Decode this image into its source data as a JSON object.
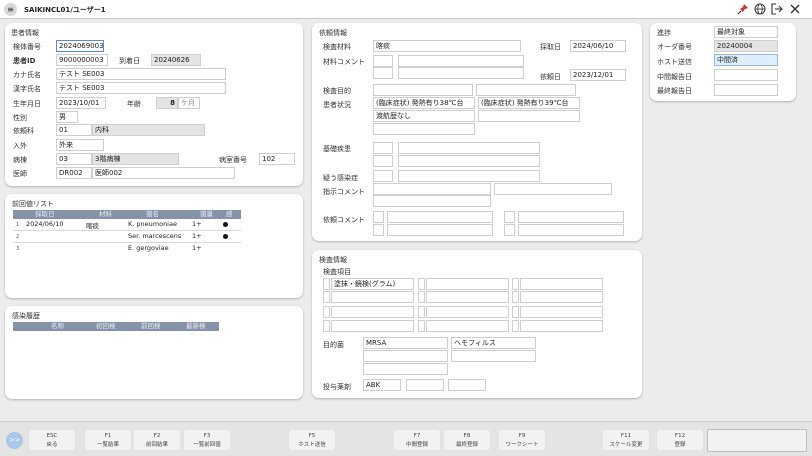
{
  "header": {
    "title": "SAIKINCL01/ユーザー1",
    "menu_glyph": "≡",
    "icons": [
      "pin-icon",
      "globe-icon",
      "logout-icon",
      "close-icon"
    ]
  },
  "patient": {
    "section_title": "患者情報",
    "specimen_no_label": "検体番号",
    "specimen_no": "2024069003",
    "patient_id_label": "患者ID",
    "patient_id": "9000000003",
    "arrival_date_label": "到着日",
    "arrival_date": "20240626",
    "kana_label": "カナ氏名",
    "kana": "テスト SE003",
    "kanji_label": "漢字氏名",
    "kanji": "テスト SE003",
    "dob_label": "生年月日",
    "dob": "2023/10/01",
    "age_label": "年齢",
    "age": "8",
    "age_unit": "ケ月",
    "sex_label": "性別",
    "sex": "男",
    "dept_label": "依頼科",
    "dept_code": "01",
    "dept_name": "内科",
    "inout_label": "入外",
    "inout": "外来",
    "ward_label": "病棟",
    "ward_code": "03",
    "ward_name": "3階病棟",
    "room_label": "病室番号",
    "room": "102",
    "doctor_label": "医師",
    "doctor_code": "DR002",
    "doctor_name": "医師002"
  },
  "request": {
    "section_title": "依頼情報",
    "material_label": "検査材料",
    "material": "喀痰",
    "collect_date_label": "採取日",
    "collect_date": "2024/06/10",
    "material_comment_label": "材料コメント",
    "request_date_label": "依頼日",
    "request_date": "2023/12/01",
    "purpose_label": "検査目的",
    "condition_label": "患者状況",
    "condition_1": "(臨床症状) 発熱有り38℃台",
    "condition_2": "(臨床症状) 発熱有り39℃台",
    "condition_3": "渡航歴なし",
    "underlying_label": "基礎疾患",
    "suspected_label": "疑う感染症",
    "instruction_label": "指示コメント",
    "request_comment_label": "依頼コメント"
  },
  "progress": {
    "progress_label": "進捗",
    "progress_value": "最終対象",
    "order_label": "オーダ番号",
    "order_value": "20240004",
    "host_label": "ホスト送信",
    "host_value": "中間済",
    "interim_label": "中間報告日",
    "final_label": "最終報告日"
  },
  "prev_results": {
    "section_title": "前回値リスト",
    "columns": [
      "採取日",
      "材料",
      "菌名",
      "菌量",
      "感"
    ],
    "rows": [
      {
        "no": "1",
        "date": "2024/06/10",
        "material": "喀痰",
        "organism": "K. pneumoniae",
        "amount": "1+",
        "mark": "●"
      },
      {
        "no": "2",
        "date": "",
        "material": "",
        "organism": "Ser. marcescens",
        "amount": "1+",
        "mark": "●"
      },
      {
        "no": "3",
        "date": "",
        "material": "",
        "organism": "E. gergoviae",
        "amount": "1+",
        "mark": ""
      }
    ]
  },
  "infection": {
    "section_title": "感染履歴",
    "columns": [
      "名称",
      "初回検",
      "前回検",
      "最新検"
    ]
  },
  "exam": {
    "section_title": "検査情報",
    "items_label": "検査項目",
    "item_1": "塗抹・鏡検(グラム)",
    "target_label": "目的菌",
    "target_1": "MRSA",
    "target_2": "ヘモフィルス",
    "drug_label": "投与薬剤",
    "drug_1": "ABK"
  },
  "footer": {
    "expand_glyph": ">>",
    "keys": [
      {
        "key": "ESC",
        "label": "戻る"
      },
      {
        "key": "F1",
        "label": "一覧結果"
      },
      {
        "key": "F2",
        "label": "前回結果"
      },
      {
        "key": "F3",
        "label": "一覧前回値"
      },
      {
        "key": "F5",
        "label": "ホスト送信"
      },
      {
        "key": "F7",
        "label": "中間登録"
      },
      {
        "key": "F8",
        "label": "最終登録"
      },
      {
        "key": "F9",
        "label": "ワークシート"
      },
      {
        "key": "F11",
        "label": "スケール変更"
      },
      {
        "key": "F12",
        "label": "登録"
      }
    ]
  }
}
